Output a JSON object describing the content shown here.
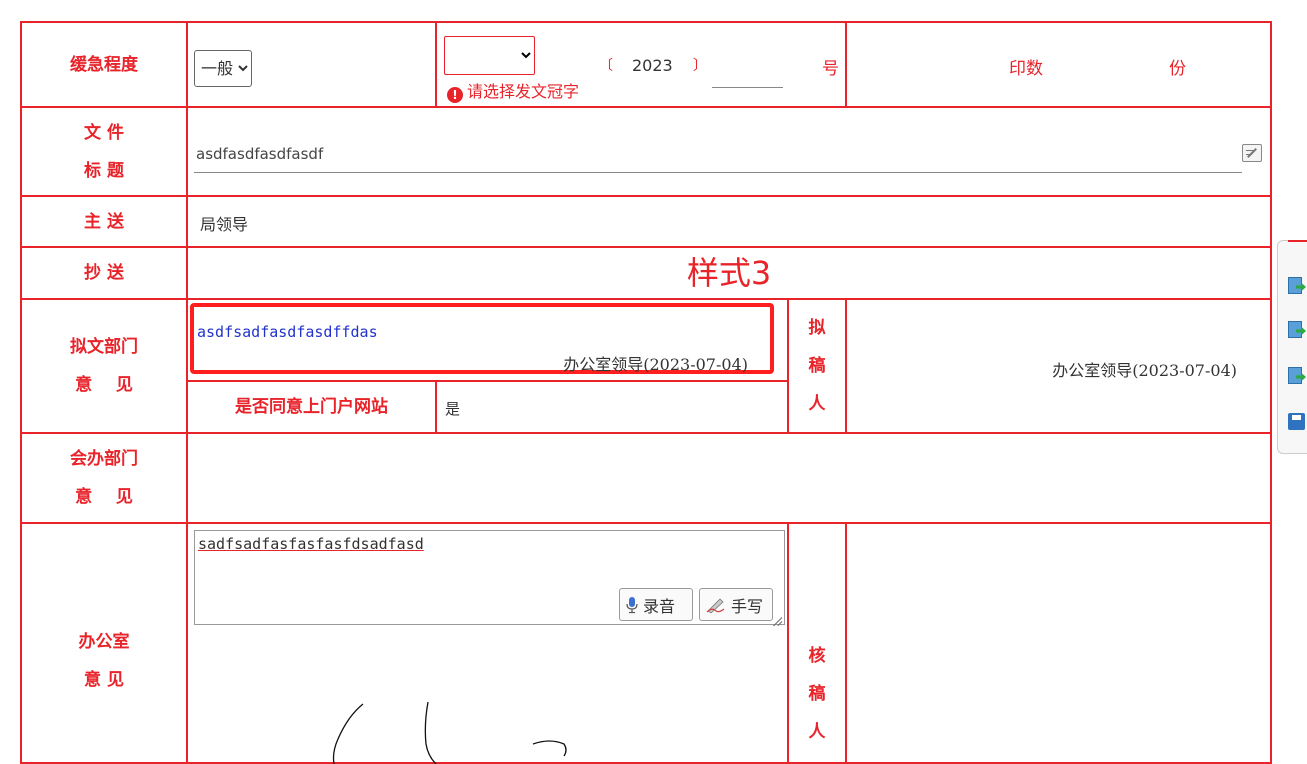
{
  "urgency": {
    "label": "缓急程度",
    "value": "一般"
  },
  "doc_number": {
    "prefix_selected": "",
    "open_paren": "〔",
    "year": "2023",
    "close_paren": "〕",
    "number_value": "",
    "suffix": "号",
    "warning": "请选择发文冠字"
  },
  "print_count": {
    "label": "印数",
    "unit": "份"
  },
  "file_title": {
    "label_line1": "文  件",
    "label_line2": "标  题",
    "value": "asdfasdfasdfasdf"
  },
  "main_send": {
    "label": "主  送",
    "value": "局领导"
  },
  "copy_send": {
    "label": "抄  送"
  },
  "style_label": "样式3",
  "drafting_dept": {
    "label_line1": "拟文部门",
    "label_line2": "意    见",
    "opinion": "asdfsadfasdfasdffdas",
    "signer": "办公室领导(2023-07-04)"
  },
  "portal": {
    "label": "是否同意上门户网站",
    "value": "是"
  },
  "drafter": {
    "label_chars": [
      "拟",
      "稿",
      "人"
    ],
    "signer": "办公室领导(2023-07-04)"
  },
  "co_dept": {
    "label_line1": "会办部门",
    "label_line2": "意    见"
  },
  "office": {
    "label_line1": "办公室",
    "label_line2": "意  见",
    "opinion": "sadfsadfasfasfasfdsadfasd",
    "record_label": "录音",
    "handwrite_label": "手写"
  },
  "reviewer": {
    "label_chars": [
      "核",
      "稿",
      "人"
    ]
  },
  "colors": {
    "accent_red": "#e8232a",
    "opinion_blue": "#2233cc",
    "highlight_border": "#ff1f1f"
  },
  "side_toolbar": {
    "icons": [
      "export-doc-icon",
      "export-doc-icon",
      "export-doc-icon",
      "save-disk-icon"
    ]
  }
}
